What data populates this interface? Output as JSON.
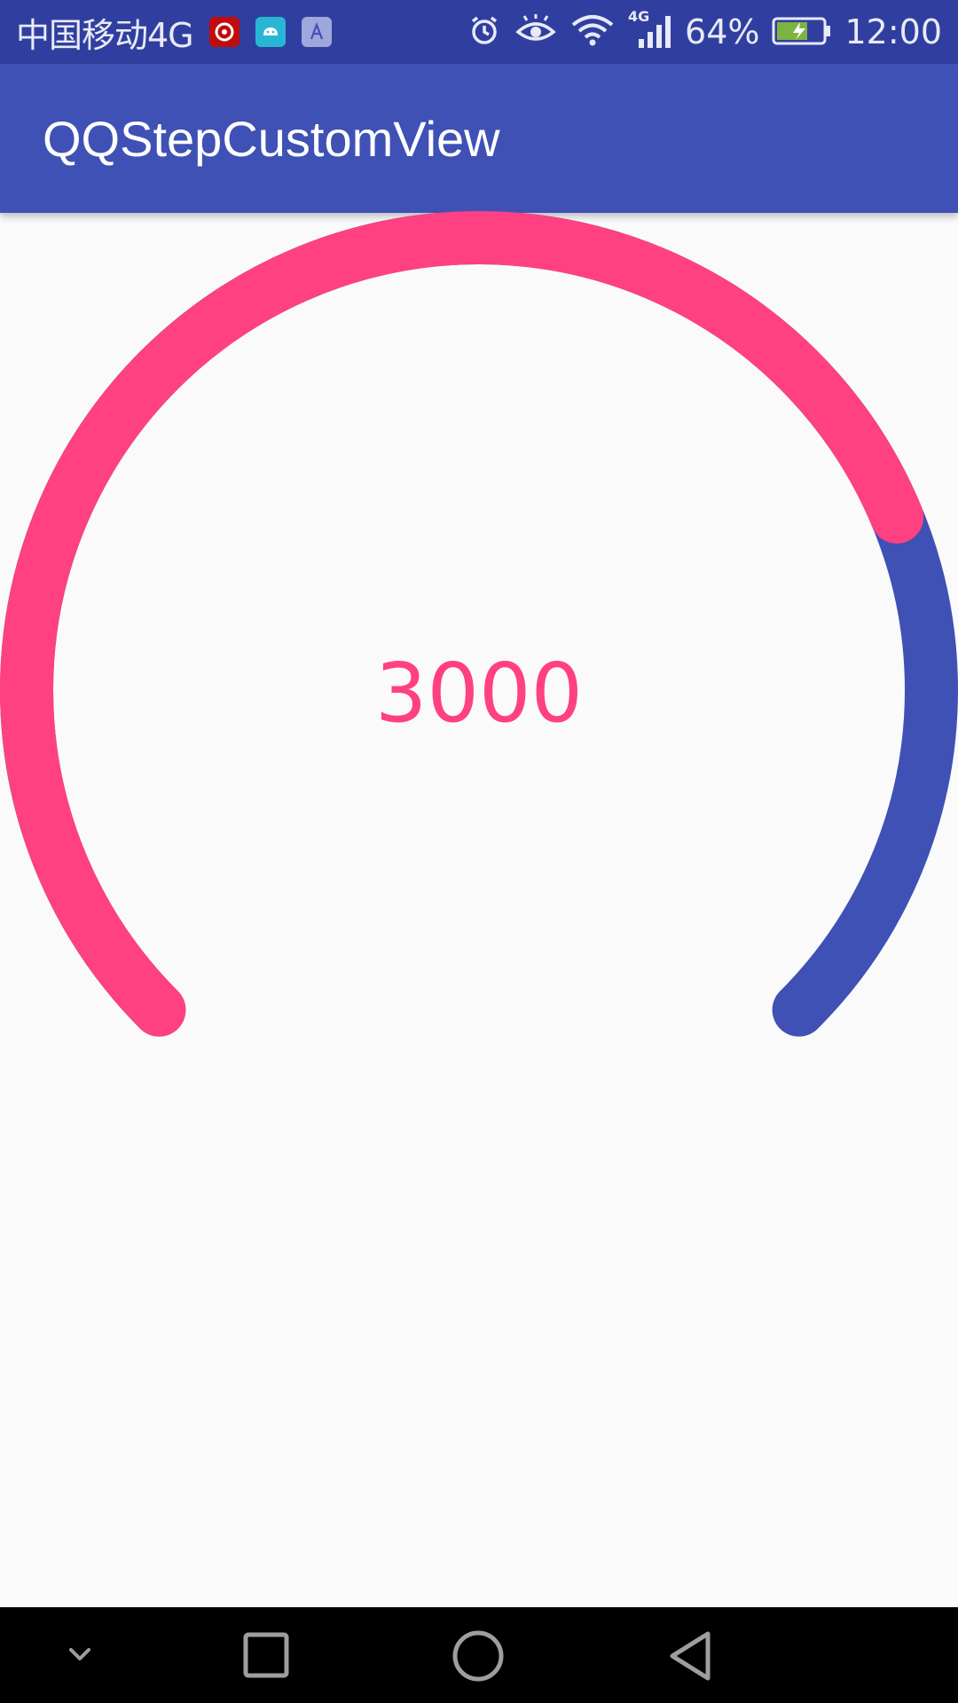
{
  "status_bar": {
    "carrier": "中国移动4G",
    "notification_icons": [
      "netease-music-icon",
      "android-icon",
      "font-a-icon"
    ],
    "network_type": "4G",
    "battery_percent": "64%",
    "time": "12:00"
  },
  "app_bar": {
    "title": "QQStepCustomView"
  },
  "step_gauge": {
    "current_steps": "3000",
    "progress_fraction": 0.75,
    "outer_color": "#3f51b5",
    "inner_color": "#ff4081"
  },
  "nav_bar": {
    "buttons": [
      "hide-keyboard-icon",
      "recents-icon",
      "home-icon",
      "back-icon"
    ]
  }
}
